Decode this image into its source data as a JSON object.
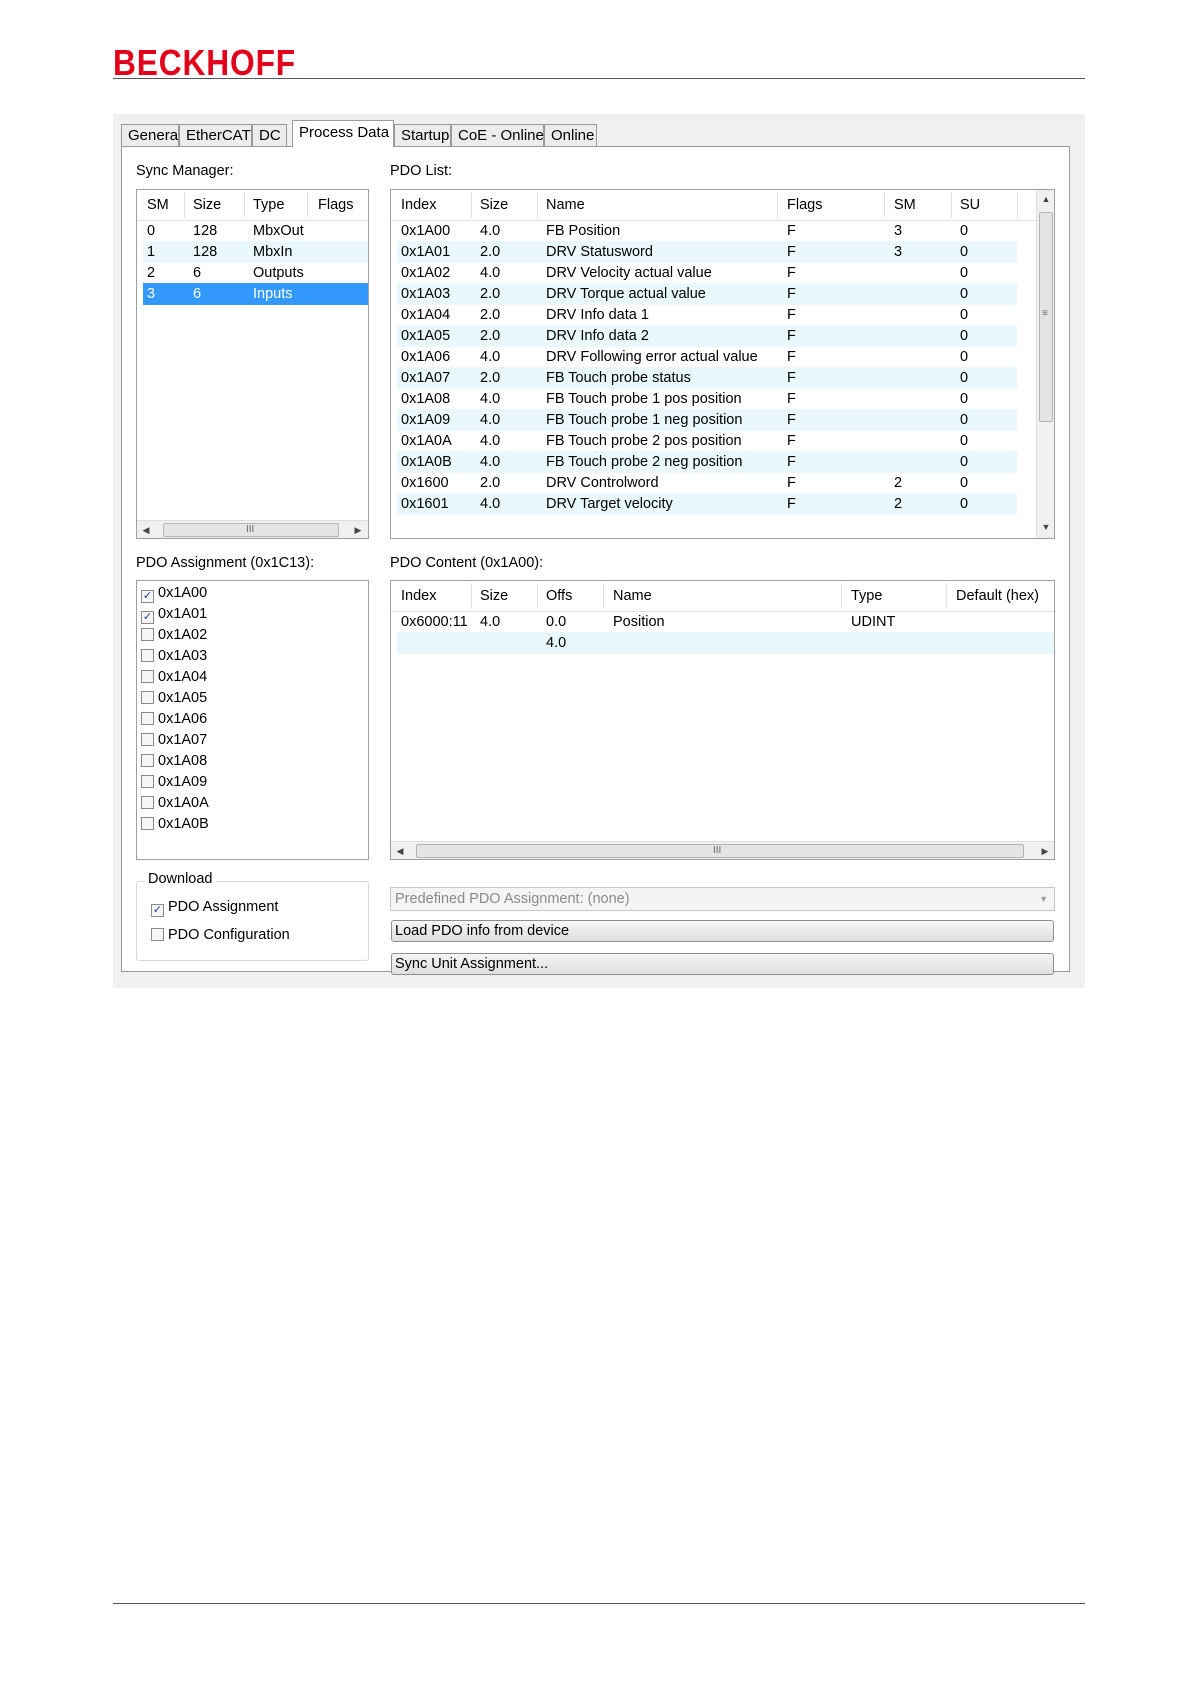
{
  "logo": {
    "text": "BECKHOFF",
    "color": "#e2001a"
  },
  "tabs": [
    {
      "label": "General",
      "active": false
    },
    {
      "label": "EtherCAT",
      "active": false
    },
    {
      "label": "DC",
      "active": false
    },
    {
      "label": "Process Data",
      "active": true
    },
    {
      "label": "Startup",
      "active": false
    },
    {
      "label": "CoE - Online",
      "active": false
    },
    {
      "label": "Online",
      "active": false
    }
  ],
  "sync_manager": {
    "label": "Sync Manager:",
    "headers": [
      "SM",
      "Size",
      "Type",
      "Flags"
    ],
    "rows": [
      {
        "sm": "0",
        "size": "128",
        "type": "MbxOut",
        "flags": ""
      },
      {
        "sm": "1",
        "size": "128",
        "type": "MbxIn",
        "flags": ""
      },
      {
        "sm": "2",
        "size": "6",
        "type": "Outputs",
        "flags": ""
      },
      {
        "sm": "3",
        "size": "6",
        "type": "Inputs",
        "flags": ""
      }
    ],
    "selected_index": 3,
    "scroll_grip": "III"
  },
  "pdo_list": {
    "label": "PDO List:",
    "headers": [
      "Index",
      "Size",
      "Name",
      "Flags",
      "SM",
      "SU"
    ],
    "rows": [
      {
        "index": "0x1A00",
        "size": "4.0",
        "name": "FB Position",
        "flags": "F",
        "sm": "3",
        "su": "0"
      },
      {
        "index": "0x1A01",
        "size": "2.0",
        "name": "DRV Statusword",
        "flags": "F",
        "sm": "3",
        "su": "0"
      },
      {
        "index": "0x1A02",
        "size": "4.0",
        "name": "DRV Velocity actual value",
        "flags": "F",
        "sm": "",
        "su": "0"
      },
      {
        "index": "0x1A03",
        "size": "2.0",
        "name": "DRV Torque actual value",
        "flags": "F",
        "sm": "",
        "su": "0"
      },
      {
        "index": "0x1A04",
        "size": "2.0",
        "name": "DRV Info data 1",
        "flags": "F",
        "sm": "",
        "su": "0"
      },
      {
        "index": "0x1A05",
        "size": "2.0",
        "name": "DRV Info data 2",
        "flags": "F",
        "sm": "",
        "su": "0"
      },
      {
        "index": "0x1A06",
        "size": "4.0",
        "name": "DRV Following error actual value",
        "flags": "F",
        "sm": "",
        "su": "0"
      },
      {
        "index": "0x1A07",
        "size": "2.0",
        "name": "FB Touch probe status",
        "flags": "F",
        "sm": "",
        "su": "0"
      },
      {
        "index": "0x1A08",
        "size": "4.0",
        "name": "FB Touch probe 1 pos position",
        "flags": "F",
        "sm": "",
        "su": "0"
      },
      {
        "index": "0x1A09",
        "size": "4.0",
        "name": "FB Touch probe 1 neg position",
        "flags": "F",
        "sm": "",
        "su": "0"
      },
      {
        "index": "0x1A0A",
        "size": "4.0",
        "name": "FB Touch probe 2 pos position",
        "flags": "F",
        "sm": "",
        "su": "0"
      },
      {
        "index": "0x1A0B",
        "size": "4.0",
        "name": "FB Touch probe 2 neg position",
        "flags": "F",
        "sm": "",
        "su": "0"
      },
      {
        "index": "0x1600",
        "size": "2.0",
        "name": "DRV Controlword",
        "flags": "F",
        "sm": "2",
        "su": "0"
      },
      {
        "index": "0x1601",
        "size": "4.0",
        "name": "DRV Target velocity",
        "flags": "F",
        "sm": "2",
        "su": "0"
      }
    ],
    "scroll_grip": "≡"
  },
  "pdo_assignment": {
    "label": "PDO Assignment (0x1C13):",
    "items": [
      {
        "label": "0x1A00",
        "checked": true
      },
      {
        "label": "0x1A01",
        "checked": true
      },
      {
        "label": "0x1A02",
        "checked": false
      },
      {
        "label": "0x1A03",
        "checked": false
      },
      {
        "label": "0x1A04",
        "checked": false
      },
      {
        "label": "0x1A05",
        "checked": false
      },
      {
        "label": "0x1A06",
        "checked": false
      },
      {
        "label": "0x1A07",
        "checked": false
      },
      {
        "label": "0x1A08",
        "checked": false
      },
      {
        "label": "0x1A09",
        "checked": false
      },
      {
        "label": "0x1A0A",
        "checked": false
      },
      {
        "label": "0x1A0B",
        "checked": false
      }
    ]
  },
  "pdo_content": {
    "label": "PDO Content (0x1A00):",
    "headers": [
      "Index",
      "Size",
      "Offs",
      "Name",
      "Type",
      "Default (hex)"
    ],
    "rows": [
      {
        "index": "0x6000:11",
        "size": "4.0",
        "offs": "0.0",
        "name": "Position",
        "type": "UDINT",
        "default": ""
      },
      {
        "index": "",
        "size": "",
        "offs": "4.0",
        "name": "",
        "type": "",
        "default": ""
      }
    ],
    "scroll_grip": "III"
  },
  "download": {
    "title": "Download",
    "pdo_assignment": {
      "label": "PDO Assignment",
      "checked": true
    },
    "pdo_configuration": {
      "label": "PDO Configuration",
      "checked": false
    }
  },
  "predefined": {
    "text": "Predefined PDO Assignment: (none)"
  },
  "buttons": {
    "load_pdo_info": "Load PDO info from device",
    "sync_unit_assignment": "Sync Unit Assignment..."
  },
  "icons": {
    "check": "✓",
    "arrow_up": "▲",
    "arrow_down": "▼",
    "arrow_left": "◀",
    "arrow_right": "▶"
  },
  "colors": {
    "selection": "#3399ff",
    "alt_row": "#e8f8fd"
  }
}
